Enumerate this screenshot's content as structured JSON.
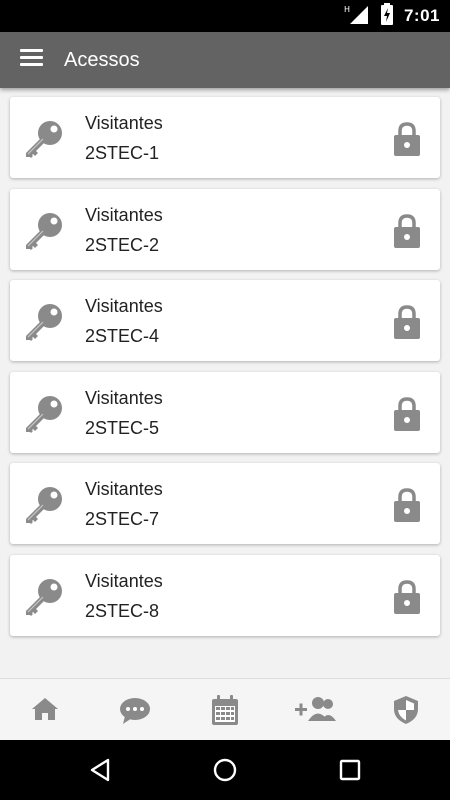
{
  "status_bar": {
    "time": "7:01",
    "icons": [
      "signal-icon",
      "battery-charging-icon"
    ]
  },
  "app_bar": {
    "title": "Acessos",
    "menu_icon": "menu-icon"
  },
  "access_list": [
    {
      "title": "Visitantes",
      "code": "2STEC-1",
      "icon": "key-icon",
      "action_icon": "lock-icon"
    },
    {
      "title": "Visitantes",
      "code": "2STEC-2",
      "icon": "key-icon",
      "action_icon": "lock-icon"
    },
    {
      "title": "Visitantes",
      "code": "2STEC-4",
      "icon": "key-icon",
      "action_icon": "lock-icon"
    },
    {
      "title": "Visitantes",
      "code": "2STEC-5",
      "icon": "key-icon",
      "action_icon": "lock-icon"
    },
    {
      "title": "Visitantes",
      "code": "2STEC-7",
      "icon": "key-icon",
      "action_icon": "lock-icon"
    },
    {
      "title": "Visitantes",
      "code": "2STEC-8",
      "icon": "key-icon",
      "action_icon": "lock-icon"
    }
  ],
  "bottom_nav": [
    "home-icon",
    "chat-icon",
    "calendar-icon",
    "add-people-icon",
    "shield-icon"
  ],
  "system_nav": [
    "back-icon",
    "home-circle-icon",
    "recents-icon"
  ],
  "colors": {
    "app_bar": "#636363",
    "icon_gray": "#8a8a8a",
    "background": "#f2f2f2"
  }
}
